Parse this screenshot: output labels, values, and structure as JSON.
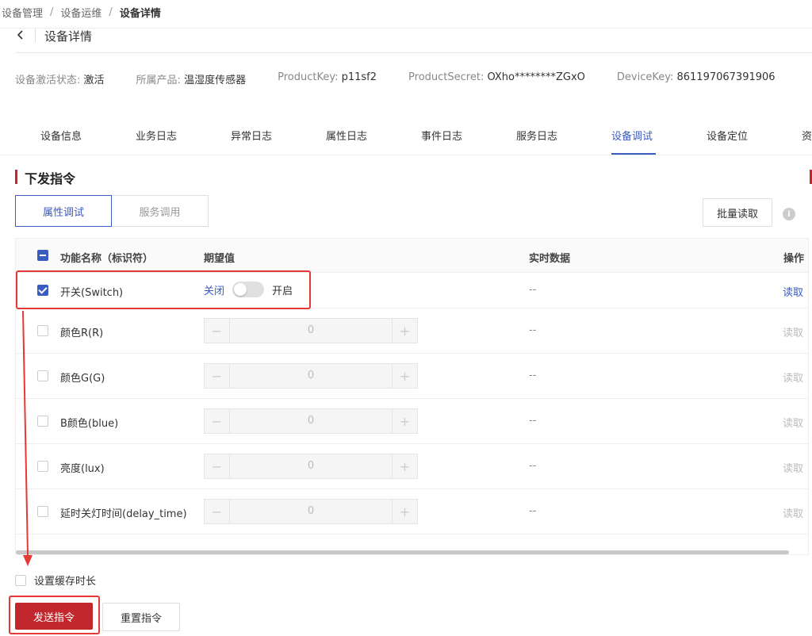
{
  "breadcrumb": {
    "items": [
      "设备管理",
      "设备运维",
      "设备详情"
    ],
    "separator": "/"
  },
  "header": {
    "back_icon": "chevron-left-icon",
    "title": "设备详情"
  },
  "info": {
    "status_label": "设备激活状态:",
    "status_value": "激活",
    "product_label": "所属产品:",
    "product_value": "温湿度传感器",
    "product_key_label": "ProductKey:",
    "product_key_value": "p11sf2",
    "product_secret_label": "ProductSecret:",
    "product_secret_value": "OXho********ZGxO",
    "device_key_label": "DeviceKey:",
    "device_key_value": "861197067391906"
  },
  "tabs": [
    "设备信息",
    "业务日志",
    "异常日志",
    "属性日志",
    "事件日志",
    "服务日志",
    "设备调试",
    "设备定位",
    "资"
  ],
  "active_tab": "设备调试",
  "section": {
    "title": "下发指令",
    "seg_options": [
      "属性调试",
      "服务调用"
    ],
    "active_seg": "属性调试",
    "batch_read": "批量读取",
    "info_icon": "info-icon"
  },
  "table": {
    "headers": {
      "name": "功能名称（标识符）",
      "expected": "期望值",
      "realtime": "实时数据",
      "operation": "操作"
    },
    "rows": [
      {
        "name": "开关(Switch)",
        "checked": true,
        "type": "switch",
        "off_label": "关闭",
        "on_label": "开启",
        "realtime": "--",
        "op": "读取"
      },
      {
        "name": "颜色R(R)",
        "checked": false,
        "type": "number",
        "value": "0",
        "realtime": "--",
        "op": "读取"
      },
      {
        "name": "颜色G(G)",
        "checked": false,
        "type": "number",
        "value": "0",
        "realtime": "--",
        "op": "读取"
      },
      {
        "name": "B颜色(blue)",
        "checked": false,
        "type": "number",
        "value": "0",
        "realtime": "--",
        "op": "读取"
      },
      {
        "name": "亮度(lux)",
        "checked": false,
        "type": "number",
        "value": "0",
        "realtime": "--",
        "op": "读取"
      },
      {
        "name": "延时关灯时间(delay_time)",
        "checked": false,
        "type": "number",
        "value": "0",
        "realtime": "--",
        "op": "读取"
      }
    ],
    "stepper_minus": "−",
    "stepper_plus": "+"
  },
  "bottom": {
    "cache_label": "设置缓存时长",
    "send_label": "发送指令",
    "reset_label": "重置指令"
  },
  "colors": {
    "primary": "#3a5bbf",
    "brand_red": "#c1272d",
    "annotation_red": "#e53935"
  }
}
